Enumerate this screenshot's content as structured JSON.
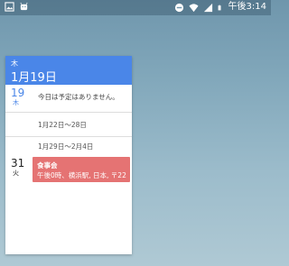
{
  "status_bar": {
    "time": "午後3:14",
    "left_icons": [
      "image-icon",
      "android-icon"
    ],
    "right_icons": [
      "minus-circle-icon",
      "wifi-icon",
      "signal-icon",
      "battery-icon"
    ]
  },
  "widget": {
    "header": {
      "day_of_week": "木",
      "date": "1月19日",
      "color": "#4a86e8"
    },
    "today": {
      "day": "19",
      "day_of_week": "木",
      "message": "今日は予定はありません。"
    },
    "weeks": [
      "1月22日～28日",
      "1月29日～2月4日"
    ],
    "event_day": {
      "day": "31",
      "day_of_week": "火"
    },
    "event": {
      "title": "食事会",
      "detail": "午後0時、横浜駅, 日本, 〒22",
      "color": "#e57373"
    }
  }
}
